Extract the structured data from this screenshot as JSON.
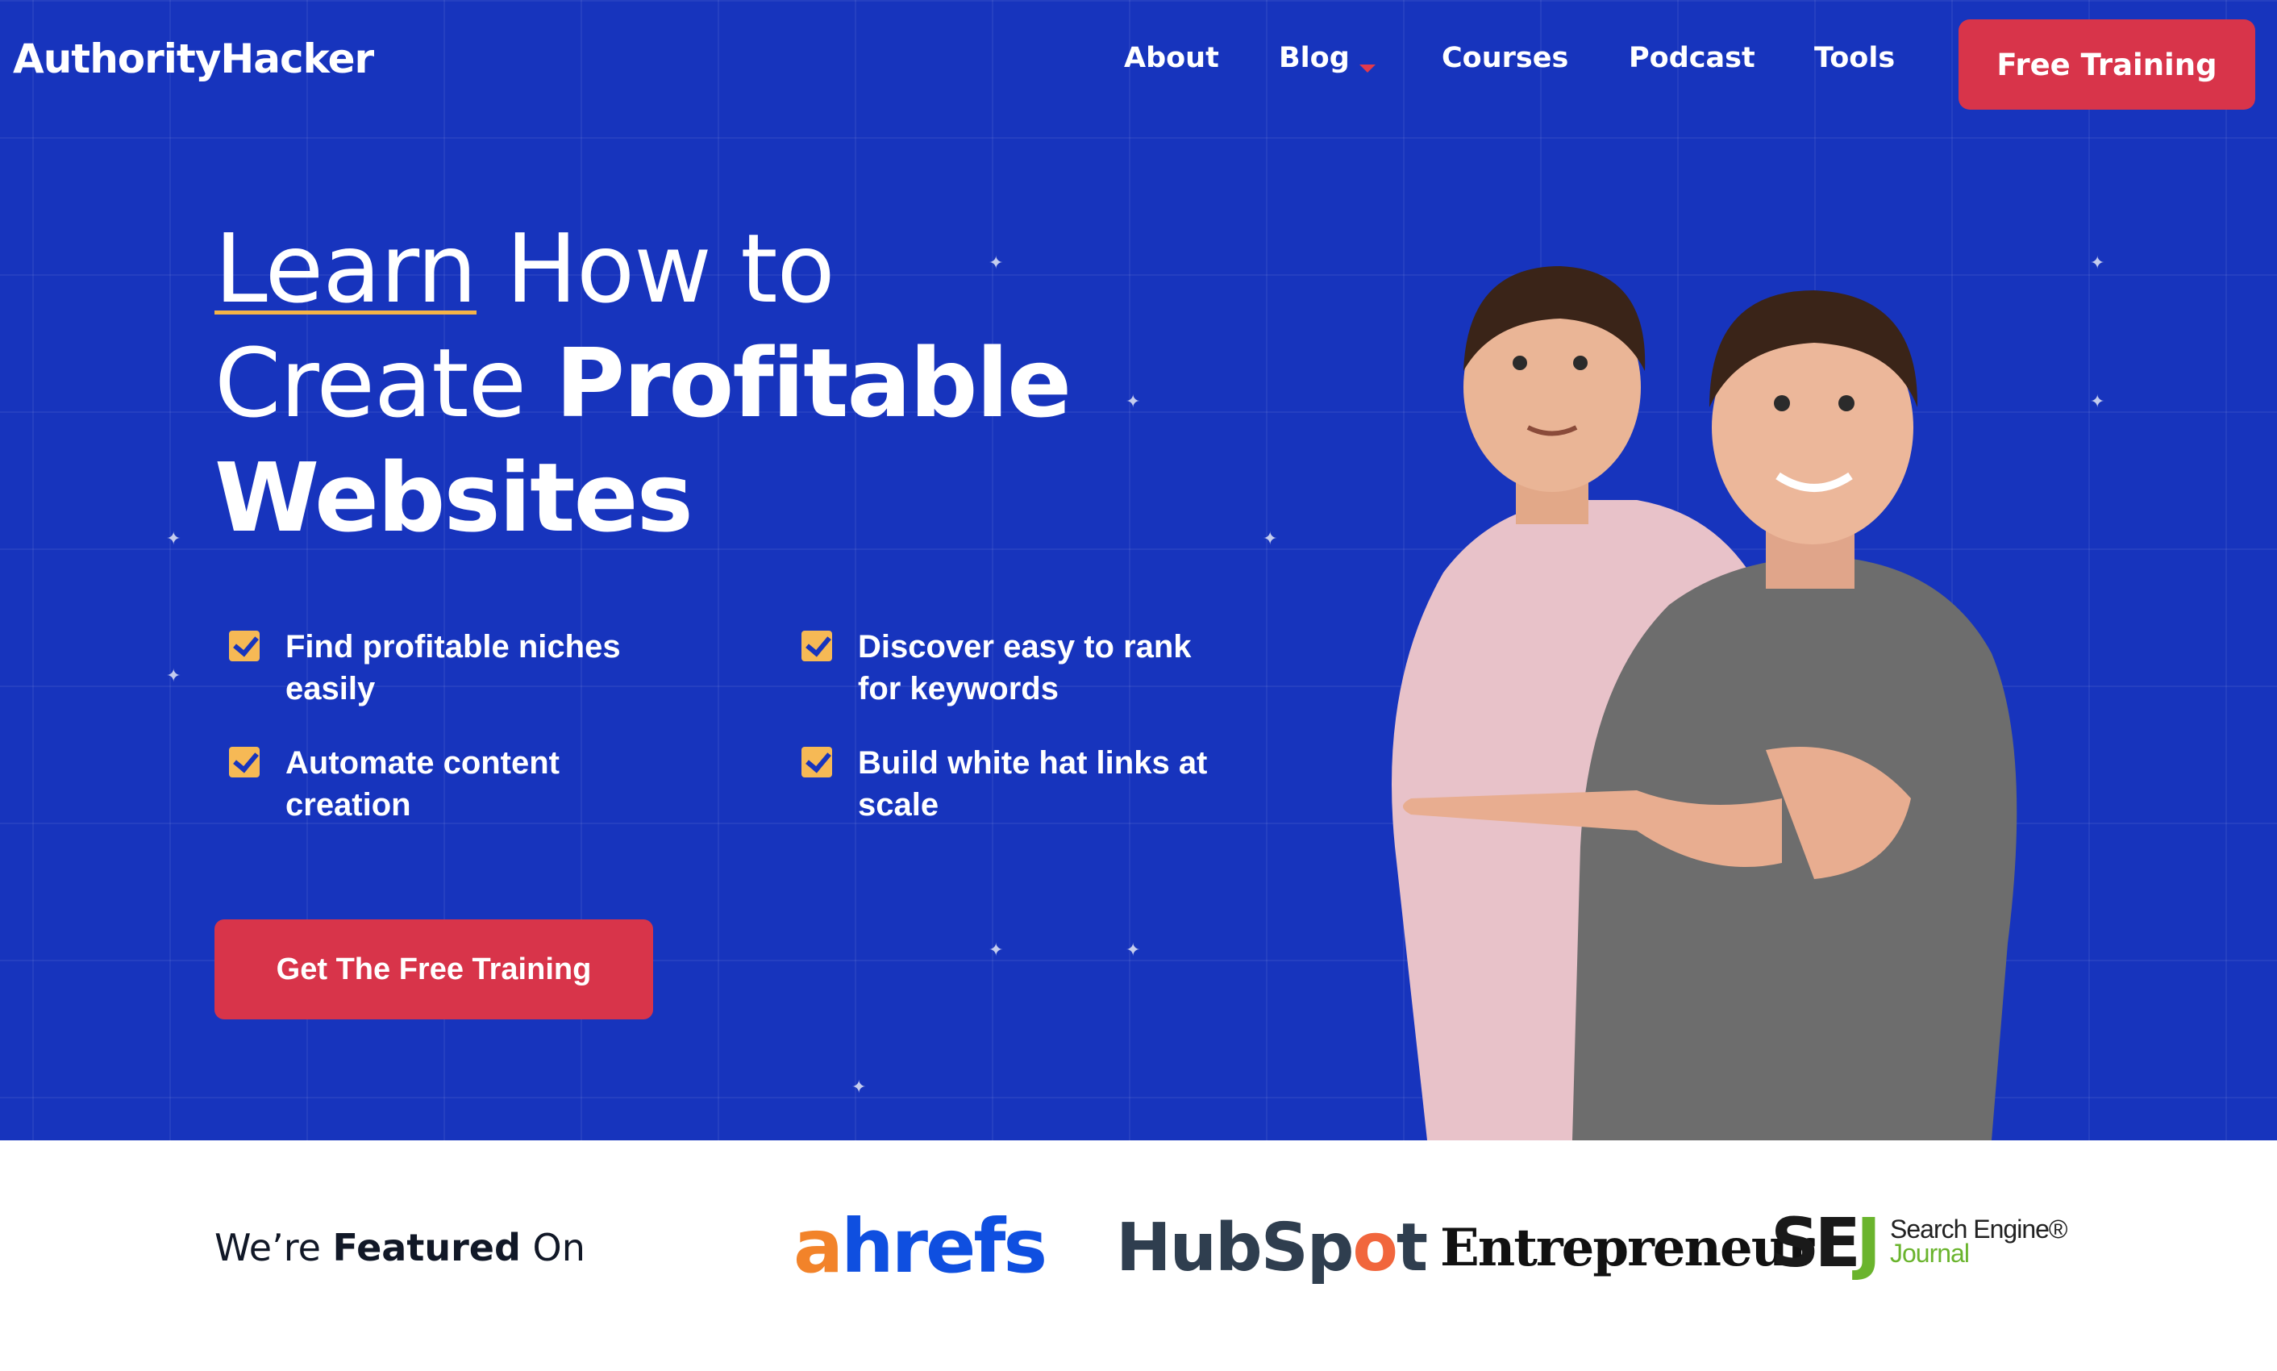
{
  "header": {
    "logo": "AuthorityHacker",
    "nav": [
      {
        "label": "About"
      },
      {
        "label": "Blog"
      },
      {
        "label": "Courses"
      },
      {
        "label": "Podcast"
      },
      {
        "label": "Tools"
      }
    ],
    "cta_label": "Free Training"
  },
  "hero": {
    "headline": {
      "line1_underlined": "Learn",
      "line1_rest": " How to",
      "line2_light": "Create ",
      "line2_bold": "Profitable",
      "line3_bold": "Websites"
    },
    "features": [
      "Find profitable niches easily",
      "Discover easy to rank for keywords",
      "Automate content creation",
      "Build white hat links at scale"
    ],
    "cta_label": "Get The Free Training"
  },
  "featured": {
    "label_pre": "We’re ",
    "label_bold": "Featured",
    "label_post": " On",
    "logos": {
      "ahrefs_a": "a",
      "ahrefs_rest": "hrefs",
      "hubspot_pre": "HubSp",
      "hubspot_o": "o",
      "hubspot_post": "t",
      "entrepreneur": "Entrepreneur",
      "sej_s": "SE",
      "sej_j": "J",
      "sej_line1": "Search Engine®",
      "sej_line2": "Journal"
    }
  },
  "colors": {
    "hero_bg": "#1734bd",
    "accent_red": "#d8344a",
    "check_yellow": "#f6b955",
    "underline": "#f5b347"
  },
  "icons": [
    "checkbox-check-icon",
    "caret-down-icon"
  ]
}
